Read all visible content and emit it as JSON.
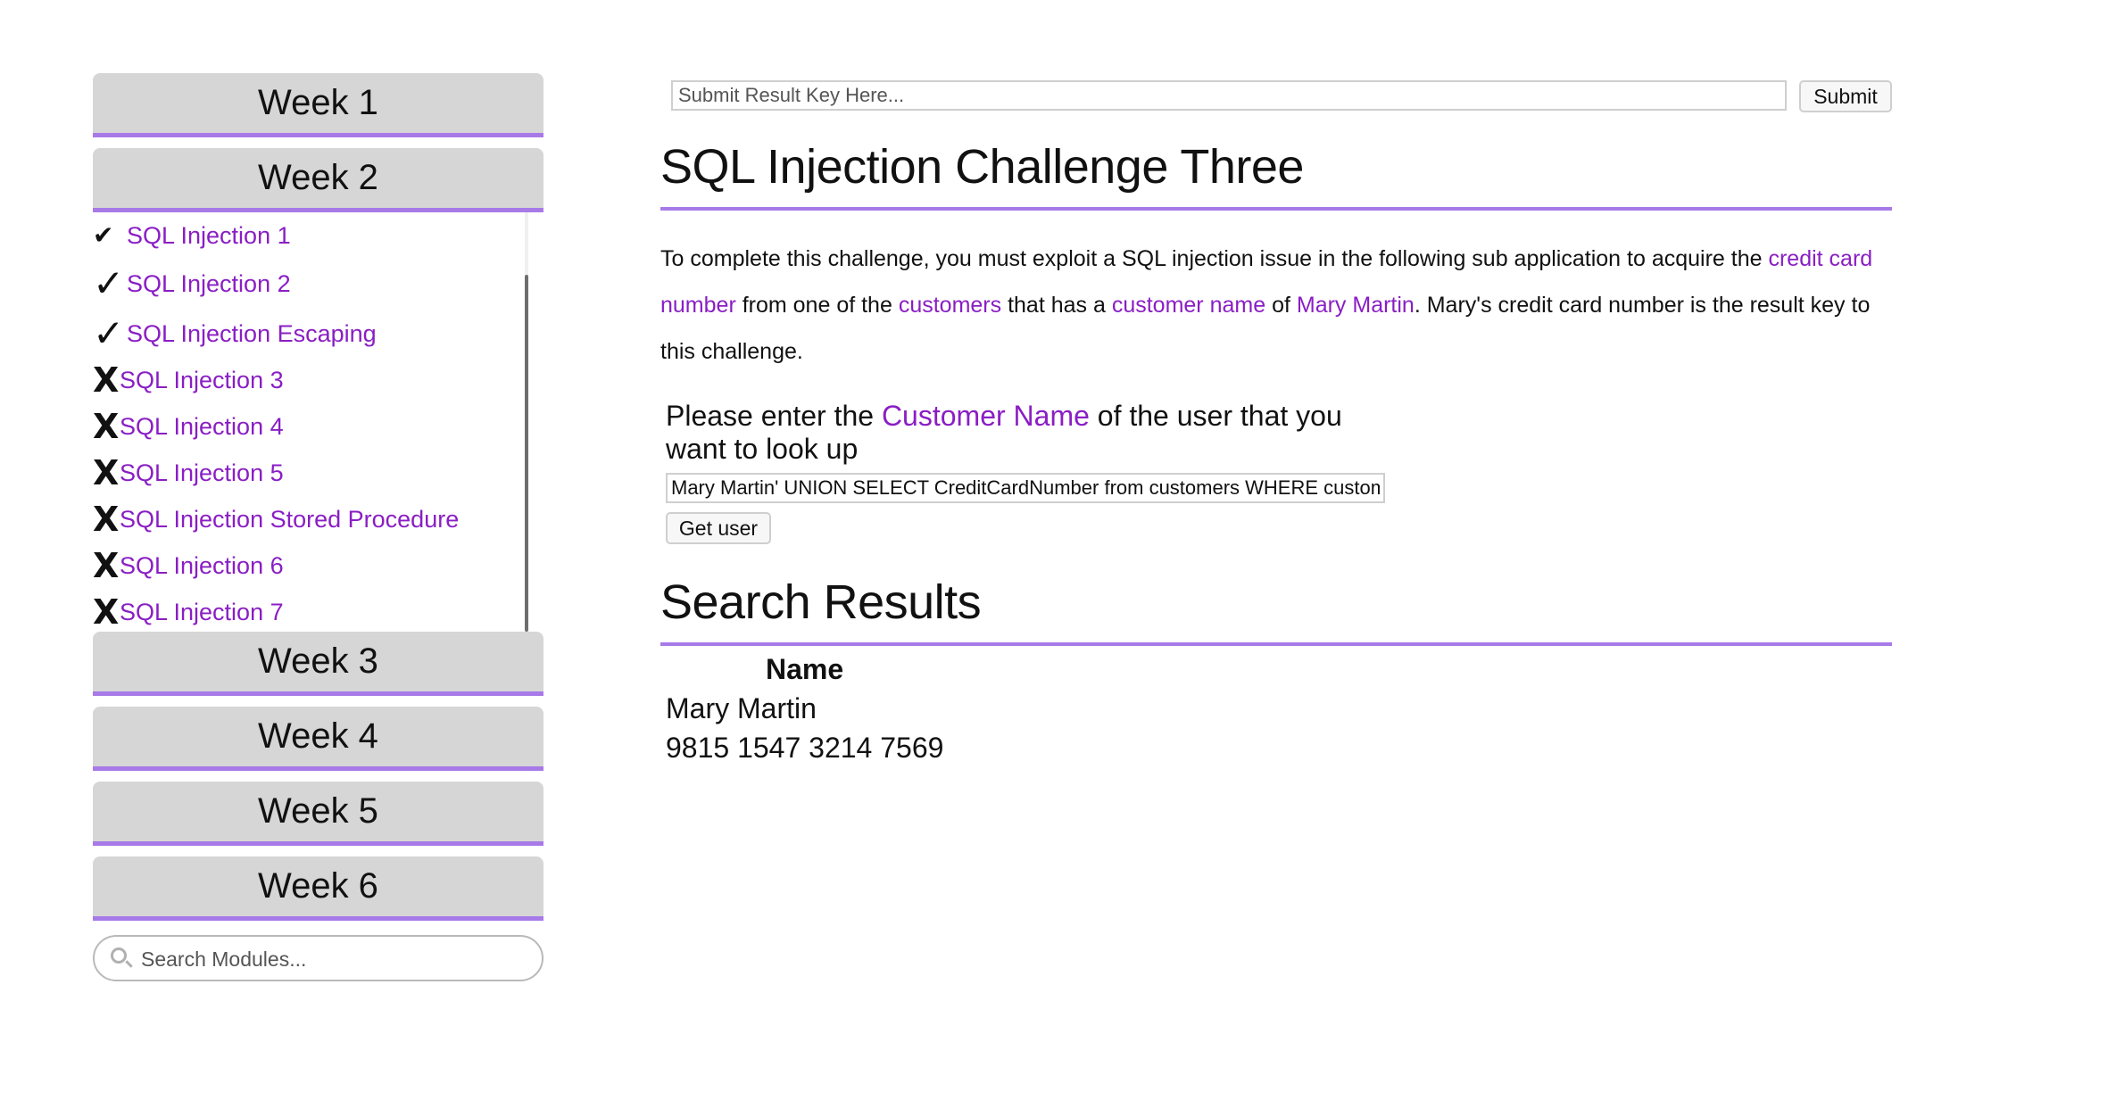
{
  "sidebar": {
    "weeks": [
      "Week 1",
      "Week 2",
      "Week 3",
      "Week 4",
      "Week 5",
      "Week 6"
    ],
    "modules": [
      {
        "status": "complete",
        "mark": "✔",
        "label": "SQL Injection 1"
      },
      {
        "status": "complete",
        "mark": "✓",
        "label": "SQL Injection 2"
      },
      {
        "status": "complete",
        "mark": "✓",
        "label": "SQL Injection Escaping"
      },
      {
        "status": "incomplete",
        "mark": "X",
        "label": "SQL Injection 3"
      },
      {
        "status": "incomplete",
        "mark": "X",
        "label": "SQL Injection 4"
      },
      {
        "status": "incomplete",
        "mark": "X",
        "label": "SQL Injection 5"
      },
      {
        "status": "incomplete",
        "mark": "X",
        "label": "SQL Injection Stored Procedure"
      },
      {
        "status": "incomplete",
        "mark": "X",
        "label": "SQL Injection 6"
      },
      {
        "status": "incomplete",
        "mark": "X",
        "label": "SQL Injection 7"
      }
    ],
    "search_placeholder": "Search Modules..."
  },
  "result_key": {
    "placeholder": "Submit Result Key Here...",
    "submit_label": "Submit"
  },
  "challenge": {
    "title": "SQL Injection Challenge Three",
    "description": {
      "part1": "To complete this challenge, you must exploit a SQL injection issue in the following sub application to acquire the ",
      "hl1": "credit card number",
      "part2": " from one of the ",
      "hl2": "customers",
      "part3": " that has a ",
      "hl3": "customer name",
      "part4": " of ",
      "hl4": "Mary Martin",
      "part5": ". Mary's credit card number is the result key to this challenge."
    },
    "lookup": {
      "prompt_before": "Please enter the ",
      "prompt_highlight": "Customer Name",
      "prompt_after": " of the user that you want to look up",
      "input_value": "Mary Martin' UNION SELECT CreditCardNumber from customers WHERE customerName='Mary Martin",
      "button_label": "Get user"
    },
    "results": {
      "title": "Search Results",
      "column_header": "Name",
      "rows": [
        "Mary Martin",
        "9815 1547 3214 7569"
      ]
    }
  },
  "colors": {
    "accent": "#a77ae8",
    "link": "#8a1ec4",
    "week_button_bg": "#d6d6d6"
  }
}
